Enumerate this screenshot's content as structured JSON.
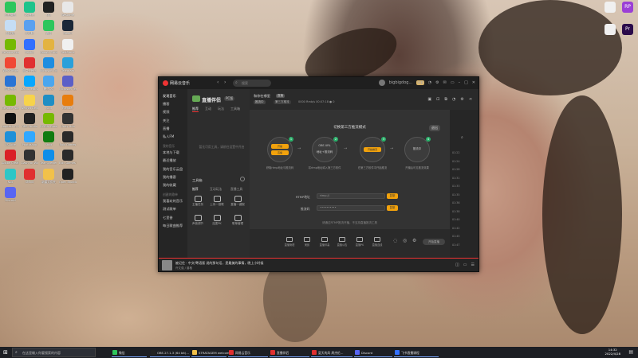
{
  "desktop": {
    "icons_left": [
      {
        "label": "企业微信",
        "color": "#2ec65c"
      },
      {
        "label": "QQ音乐",
        "color": "#1ec38b"
      },
      {
        "label": "QQ",
        "color": "#222222"
      },
      {
        "label": "WeGame",
        "color": "#e8e8e8"
      },
      {
        "label": "回收站",
        "color": "#c5ddf5"
      },
      {
        "label": "此电脑",
        "color": "#5aa0f0"
      },
      {
        "label": "微信",
        "color": "#2ec65c"
      },
      {
        "label": "Steam",
        "color": "#1b2838"
      },
      {
        "label": "GeForce Experience",
        "color": "#76b900"
      },
      {
        "label": "Feishu",
        "color": "#3370ff"
      },
      {
        "label": "Google Chrome",
        "color": "#e3b341"
      },
      {
        "label": "FastStone",
        "color": "#f0f0f0"
      },
      {
        "label": "WPS Office",
        "color": "#f04834"
      },
      {
        "label": "网易云音乐",
        "color": "#e03030"
      },
      {
        "label": "Microsoft Edge",
        "color": "#1e8de0"
      },
      {
        "label": "Telegram",
        "color": "#2aa0da"
      },
      {
        "label": "控制面板",
        "color": "#2a74d5"
      },
      {
        "label": "BaiduNetdisk",
        "color": "#06a7ff"
      },
      {
        "label": "腾讯QQ",
        "color": "#4aa6ee"
      },
      {
        "label": "Microsoft Teams",
        "color": "#5b5fc7"
      },
      {
        "label": "GeForce Now",
        "color": "#76b900"
      },
      {
        "label": "Wechat Devtools",
        "color": "#f7d34a"
      },
      {
        "label": "Kodi",
        "color": "#1f8ec4"
      },
      {
        "label": "Blender",
        "color": "#e87d0d"
      },
      {
        "label": "Logitech G HUB",
        "color": "#111111"
      },
      {
        "label": "OBS Studio",
        "color": "#222222"
      },
      {
        "label": "NVIDIA Broadcast",
        "color": "#76b900"
      },
      {
        "label": "Unity Hub",
        "color": "#333333"
      },
      {
        "label": "VSCode",
        "color": "#1e90d8"
      },
      {
        "label": "Photoshop",
        "color": "#31a8ff"
      },
      {
        "label": "Xbox",
        "color": "#107c10"
      },
      {
        "label": "Epic Games",
        "color": "#2a2a2a"
      },
      {
        "label": "Adobe Creative Cloud",
        "color": "#da1f26"
      },
      {
        "label": "Clash for Windows",
        "color": "#333333"
      },
      {
        "label": "TeamViewer",
        "color": "#0e8ee9"
      },
      {
        "label": "Epic Games Launcher",
        "color": "#2a2a2a"
      },
      {
        "label": "Nox",
        "color": "#2ec6c6"
      },
      {
        "label": "XMind",
        "color": "#e03030"
      },
      {
        "label": "新建文件夹",
        "color": "#f2c14a"
      },
      {
        "label": "Open Broadcaster",
        "color": "#222222"
      },
      {
        "label": "Discord",
        "color": "#5865f2"
      }
    ],
    "icons_right": [
      {
        "label": "",
        "color": "#f0f0f0"
      },
      {
        "label": "RP",
        "color": "#9b3fd6"
      },
      {
        "label": "",
        "color": "#f0f0f0"
      },
      {
        "label": "Pr",
        "color": "#2a0a4a"
      }
    ]
  },
  "app": {
    "title": "网易云音乐",
    "search_placeholder": "搜索",
    "username": "bigbigdog...",
    "vip": "vip",
    "sidebar": {
      "items": [
        "发现音乐",
        "播客",
        "视频",
        "关注",
        "直播",
        "私人FM"
      ],
      "section_mine": "我的音乐",
      "mine_items": [
        "本地与下载",
        "最近播放",
        "我的音乐云盘",
        "我的播客",
        "我的收藏"
      ],
      "section_playlists": "创建的歌单",
      "playlist_items": [
        "我喜欢的音乐",
        "测试歌单",
        "七里香",
        "每日歌曲推荐"
      ]
    },
    "live": {
      "title": "直播伴侣",
      "version": "PC版",
      "tabs": [
        "推荐",
        "互动",
        "玩法",
        "工具箱"
      ],
      "hint": "暂无可用工具，请前往设置中开启",
      "toolbox_title": "工具箱",
      "toolbox_tabs": [
        "推荐",
        "互动玩法",
        "直播工具"
      ],
      "tools": [
        "主播任务",
        "上传一首歌",
        "直播一键报",
        "声音调节",
        "连麦PK",
        "歌单管理"
      ]
    },
    "right": {
      "name": "和你在哪里",
      "badge": "直播",
      "status": "推流中",
      "mode": "第三方推流",
      "info": "0000 Rmb/s  00:07:18  ● 0",
      "third_title": "切换第三方推流模式",
      "exit": "退出",
      "steps": [
        {
          "num": "1",
          "inner_a": "开播",
          "inner_b": "直播",
          "caption": "获取rtmp地址与推流码"
        },
        {
          "num": "2",
          "inner_a": "OBS URL",
          "inner_b": "地址+推流码",
          "caption": "将rtmp地址填入第三方软件"
        },
        {
          "num": "3",
          "inner_a": "开始推流",
          "inner_b": "",
          "caption": "在第三方软件中开始推流"
        },
        {
          "num": "4",
          "inner_a": "",
          "inner_b": "推流中",
          "caption": "开播后可见推流效果"
        }
      ],
      "fields": [
        {
          "label": "RTMP地址",
          "value": "rtmp://",
          "btn": "复制"
        },
        {
          "label": "推流码",
          "value": "••••••••••",
          "btn": "复制"
        }
      ],
      "bottom_hint": "请通过RTMP推流开播，不支持直播推流工具",
      "right_list": [
        "01:22",
        "01:24",
        "01:28",
        "01:31",
        "01:33",
        "01:35",
        "01:36",
        "01:38",
        "01:40",
        "01:42",
        "01:45",
        "01:47"
      ],
      "controls": [
        "直播管理",
        "美颜",
        "直播伴奏",
        "直播公告",
        "直播PK",
        "直播连线"
      ],
      "golive": "开始直播"
    },
    "player": {
      "song": "被记住 · 中文/粤语版    说的那句话，是最美的事情，晚上小时候",
      "artist": "许文强 / 曾格"
    }
  },
  "taskbar": {
    "search_placeholder": "在这里输入你要搜索的内容",
    "tasks": [
      {
        "label": "微信",
        "color": "#2ec65c"
      },
      {
        "label": "OBS 27.1.3 (64 bit)...",
        "color": "#222222"
      },
      {
        "label": "STRATAGEM welcome...",
        "color": "#f2c14a"
      },
      {
        "label": "网易云音乐",
        "color": "#e03030"
      },
      {
        "label": "直播伴侣",
        "color": "#e03030"
      },
      {
        "label": "夏天的风 周杰伦...",
        "color": "#e03030"
      },
      {
        "label": "Discord",
        "color": "#5865f2"
      },
      {
        "label": "飞书直播课程",
        "color": "#3370ff"
      }
    ],
    "time": "14:32",
    "date": "2022/4/28"
  }
}
